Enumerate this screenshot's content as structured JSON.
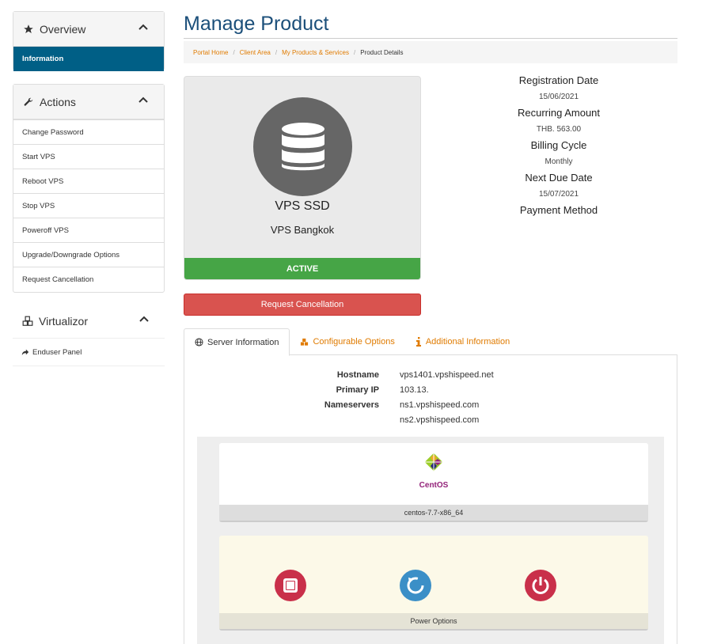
{
  "sidebar": {
    "overview": {
      "title": "Overview",
      "items": [
        "Information"
      ]
    },
    "actions": {
      "title": "Actions",
      "items": [
        "Change Password",
        "Start VPS",
        "Reboot VPS",
        "Stop VPS",
        "Poweroff VPS",
        "Upgrade/Downgrade Options",
        "Request Cancellation"
      ]
    },
    "virtualizor": {
      "title": "Virtualizor",
      "items": [
        "Enduser Panel"
      ]
    }
  },
  "page": {
    "title": "Manage Product"
  },
  "breadcrumb": [
    "Portal Home",
    "Client Area",
    "My Products & Services",
    "Product Details"
  ],
  "product": {
    "name": "VPS SSD",
    "group": "VPS Bangkok",
    "status": "ACTIVE"
  },
  "cancel_button": "Request Cancellation",
  "details": [
    {
      "label": "Registration Date",
      "value": "15/06/2021"
    },
    {
      "label": "Recurring Amount",
      "value": "THB. 563.00"
    },
    {
      "label": "Billing Cycle",
      "value": "Monthly"
    },
    {
      "label": "Next Due Date",
      "value": "15/07/2021"
    },
    {
      "label": "Payment Method",
      "value": ""
    }
  ],
  "tabs": [
    "Server Information",
    "Configurable Options",
    "Additional Information"
  ],
  "server": {
    "hostname_label": "Hostname",
    "hostname": "vps1401.vpshispeed.net",
    "ip_label": "Primary IP",
    "ip": "103.13.",
    "ns_label": "Nameservers",
    "ns1": "ns1.vpshispeed.com",
    "ns2": "ns2.vpshispeed.com"
  },
  "os": {
    "logo_text": "CentOS",
    "name": "centos-7.7-x86_64"
  },
  "power": {
    "label": "Power Options"
  },
  "colors": {
    "accent": "#005f86",
    "link": "#e07b00",
    "active": "#46a546",
    "danger": "#d9534f",
    "title": "#1b4f7a"
  }
}
